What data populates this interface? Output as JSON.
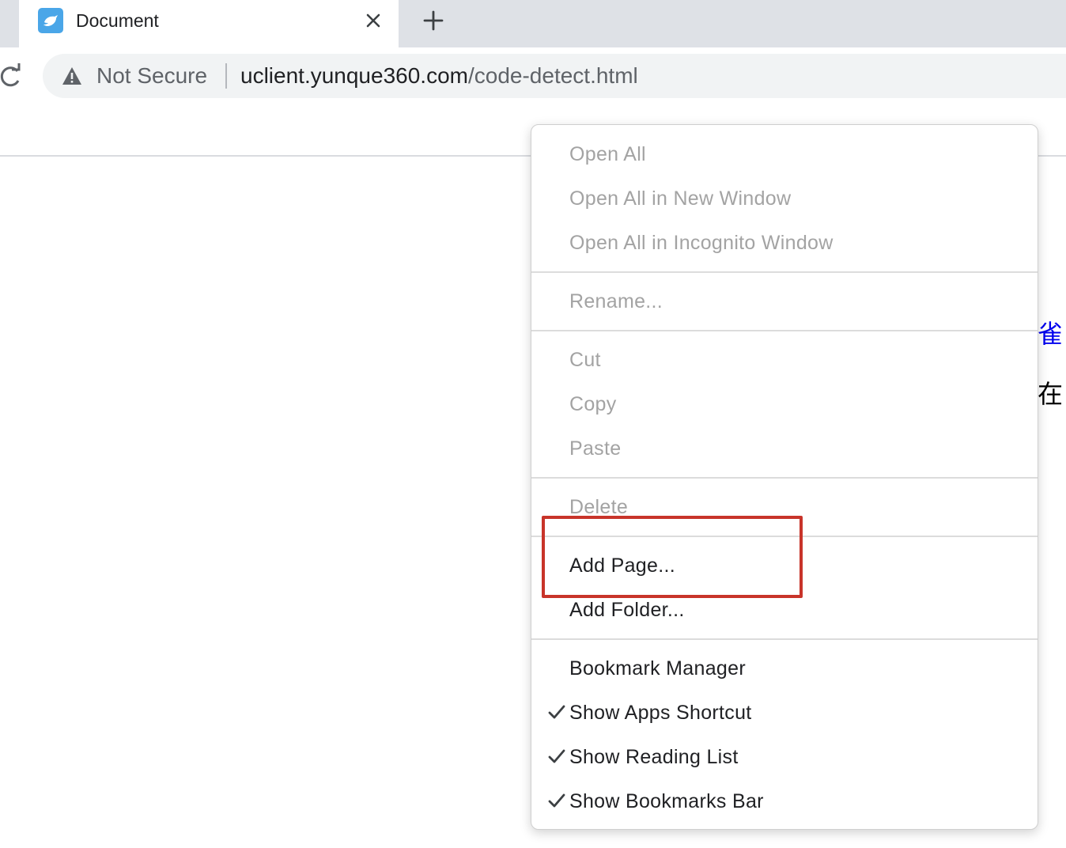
{
  "tab": {
    "title": "Document",
    "favicon": "bird-icon",
    "close_icon": "close-icon",
    "new_tab_icon": "plus-icon"
  },
  "toolbar": {
    "reload_icon": "reload-icon",
    "security_icon": "warning-icon",
    "security_label": "Not Secure",
    "url_host": "uclient.yunque360.com",
    "url_path": "/code-detect.html"
  },
  "page": {
    "fragment_link": "雀",
    "fragment_text": "在"
  },
  "context_menu": {
    "items": [
      {
        "label": "Open All",
        "enabled": false,
        "checked": false
      },
      {
        "label": "Open All in New Window",
        "enabled": false,
        "checked": false
      },
      {
        "label": "Open All in Incognito Window",
        "enabled": false,
        "checked": false
      },
      {
        "label": "Rename...",
        "enabled": false,
        "checked": false
      },
      {
        "label": "Cut",
        "enabled": false,
        "checked": false
      },
      {
        "label": "Copy",
        "enabled": false,
        "checked": false
      },
      {
        "label": "Paste",
        "enabled": false,
        "checked": false
      },
      {
        "label": "Delete",
        "enabled": false,
        "checked": false
      },
      {
        "label": "Add Page...",
        "enabled": true,
        "checked": false
      },
      {
        "label": "Add Folder...",
        "enabled": true,
        "checked": false
      },
      {
        "label": "Bookmark Manager",
        "enabled": true,
        "checked": false
      },
      {
        "label": "Show Apps Shortcut",
        "enabled": true,
        "checked": true
      },
      {
        "label": "Show Reading List",
        "enabled": true,
        "checked": true
      },
      {
        "label": "Show Bookmarks Bar",
        "enabled": true,
        "checked": true
      }
    ]
  },
  "annotation": {
    "highlight_color": "#c8342a",
    "highlighted_item": "Add Page..."
  },
  "colors": {
    "tabstrip": "#dee1e6",
    "omnibox": "#f1f3f4",
    "disabled_text": "#a3a3a3",
    "link": "#0000ee"
  }
}
